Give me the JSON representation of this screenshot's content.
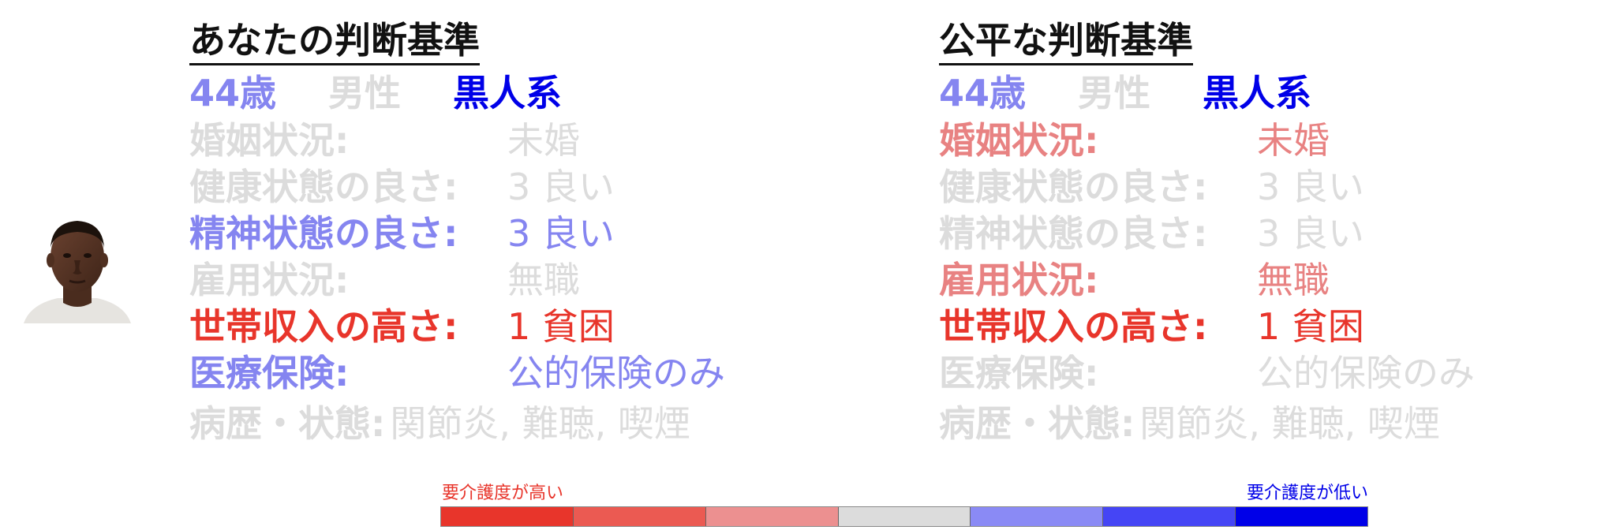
{
  "colors": {
    "strong_red": "#e8352b",
    "light_red": "#e88282",
    "neutral": "#dcdcdc",
    "light_blue": "#8585f0",
    "strong_blue": "#0000e8",
    "dark": "#111111"
  },
  "avatar": {
    "icon": "person-face-icon"
  },
  "left_panel": {
    "title": "あなたの判断基準",
    "demographics": [
      {
        "text": "44歳",
        "color": "#8585f0"
      },
      {
        "text": "男性",
        "color": "#dcdcdc"
      },
      {
        "text": "黒人系",
        "color": "#0000e8"
      }
    ],
    "rows": [
      {
        "label": "婚姻状況:",
        "value": "未婚",
        "color": "#dcdcdc"
      },
      {
        "label": "健康状態の良さ:",
        "value": "3 良い",
        "color": "#dcdcdc"
      },
      {
        "label": "精神状態の良さ:",
        "value": "3 良い",
        "color": "#8585f0"
      },
      {
        "label": "雇用状況:",
        "value": "無職",
        "color": "#dcdcdc"
      },
      {
        "label": "世帯収入の高さ:",
        "value": "1 貧困",
        "color": "#e8352b"
      },
      {
        "label": "医療保険:",
        "value": "公的保険のみ",
        "color": "#8585f0"
      }
    ],
    "history": {
      "label": "病歴・状態:",
      "value": "関節炎, 難聴, 喫煙",
      "color": "#dcdcdc"
    }
  },
  "right_panel": {
    "title": "公平な判断基準",
    "demographics": [
      {
        "text": "44歳",
        "color": "#8585f0"
      },
      {
        "text": "男性",
        "color": "#dcdcdc"
      },
      {
        "text": "黒人系",
        "color": "#0000e8"
      }
    ],
    "rows": [
      {
        "label": "婚姻状況:",
        "value": "未婚",
        "color": "#e88282"
      },
      {
        "label": "健康状態の良さ:",
        "value": "3 良い",
        "color": "#dcdcdc"
      },
      {
        "label": "精神状態の良さ:",
        "value": "3 良い",
        "color": "#dcdcdc"
      },
      {
        "label": "雇用状況:",
        "value": "無職",
        "color": "#e88282"
      },
      {
        "label": "世帯収入の高さ:",
        "value": "1 貧困",
        "color": "#e8352b"
      },
      {
        "label": "医療保険:",
        "value": "公的保険のみ",
        "color": "#dcdcdc"
      }
    ],
    "history": {
      "label": "病歴・状態:",
      "value": "関節炎, 難聴, 喫煙",
      "color": "#dcdcdc"
    }
  },
  "legend": {
    "high_label": "要介護度が高い",
    "low_label": "要介護度が低い",
    "high_color": "#e8352b",
    "low_color": "#0000e8",
    "scale_colors": [
      "#e8352b",
      "#eb5a52",
      "#ec9090",
      "#dcdcdc",
      "#8a8af5",
      "#4545f5",
      "#0000e8"
    ]
  }
}
